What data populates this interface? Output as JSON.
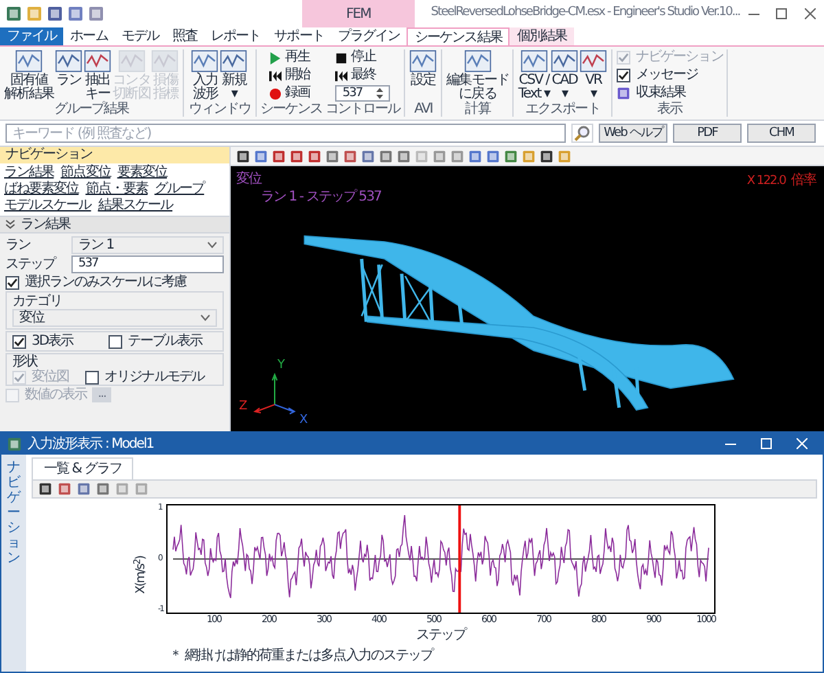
{
  "title_bar": {
    "title": "SteelReversedLohseBridge-CM.esx - Engineer's Studio Ver.10...",
    "context_tab": "FEM"
  },
  "tabs": [
    {
      "label": "ファイル",
      "kind": "file",
      "selected": false
    },
    {
      "label": "ホーム",
      "kind": "normal",
      "selected": false
    },
    {
      "label": "モデル",
      "kind": "normal",
      "selected": false
    },
    {
      "label": "照査",
      "kind": "normal",
      "selected": false
    },
    {
      "label": "レポート",
      "kind": "normal",
      "selected": false
    },
    {
      "label": "サポート",
      "kind": "normal",
      "selected": false
    },
    {
      "label": "プラグイン",
      "kind": "normal",
      "selected": false
    },
    {
      "label": "シーケンス結果",
      "kind": "context",
      "selected": true
    },
    {
      "label": "個別結果",
      "kind": "context",
      "selected": false
    }
  ],
  "ribbon_groups": [
    {
      "label": "グループ結果",
      "kind": "buttons",
      "items": [
        {
          "lines": [
            "固有値",
            "解析結果"
          ],
          "disabled": false
        },
        {
          "lines": [
            "ラン"
          ],
          "disabled": false
        },
        {
          "lines": [
            "抽出",
            "キー"
          ],
          "disabled": false
        },
        {
          "lines": [
            "コンタ",
            "切断図"
          ],
          "disabled": true
        },
        {
          "lines": [
            "損傷",
            "指標"
          ],
          "disabled": true
        }
      ]
    },
    {
      "label": "ウィンドウ",
      "kind": "buttons",
      "items": [
        {
          "lines": [
            "入力",
            "波形"
          ],
          "disabled": false
        },
        {
          "lines": [
            "新規",
            "▾"
          ],
          "disabled": false
        }
      ]
    },
    {
      "label": "シーケンス コントロール",
      "kind": "sequence",
      "items": [
        {
          "lines": [
            "再生"
          ]
        },
        {
          "lines": [
            "停止"
          ]
        },
        {
          "lines": [
            "開始"
          ]
        },
        {
          "lines": [
            "最終"
          ]
        },
        {
          "lines": [
            "録画"
          ]
        }
      ],
      "step": "537"
    },
    {
      "label": "AVI",
      "kind": "buttons",
      "items": [
        {
          "lines": [
            "設定"
          ],
          "disabled": false
        }
      ]
    },
    {
      "label": "計算",
      "kind": "buttons",
      "items": [
        {
          "lines": [
            "編集モード",
            "に戻る"
          ],
          "disabled": false
        }
      ]
    },
    {
      "label": "エクスポート",
      "kind": "buttons",
      "items": [
        {
          "lines": [
            "CSV /",
            "Text ▾"
          ],
          "disabled": false
        },
        {
          "lines": [
            "CAD",
            "▾"
          ],
          "disabled": false
        },
        {
          "lines": [
            "VR",
            "▾"
          ],
          "disabled": false
        }
      ]
    },
    {
      "label": "表示",
      "kind": "checks",
      "items": [
        {
          "lines": [
            "ナビゲーション"
          ],
          "kind": "check",
          "checked": true,
          "disabled": true
        },
        {
          "lines": [
            "メッセージ"
          ],
          "kind": "check",
          "checked": true,
          "disabled": false
        },
        {
          "lines": [
            "収束結果"
          ],
          "kind": "icon"
        }
      ]
    }
  ],
  "search": {
    "placeholder": "キーワード (例 照査など)",
    "buttons": [
      "Web ヘルプ",
      "PDF",
      "CHM"
    ]
  },
  "navigation": {
    "title": "ナビゲーション",
    "links": [
      "ラン結果",
      "節点変位",
      "要素変位",
      "ばね要素変位",
      "節点・要素",
      "グループ",
      "モデルスケール",
      "結果スケール"
    ],
    "section": "ラン結果",
    "run": {
      "label": "ラン",
      "value": "ラン 1"
    },
    "step": {
      "label": "ステップ",
      "value": "537"
    },
    "scale_only_selected": {
      "label": "選択ランのみスケールに考慮",
      "checked": true
    },
    "category": {
      "label": "カテゴリ",
      "value": "変位"
    },
    "show_3d": {
      "label": "3D表示",
      "checked": true
    },
    "show_table": {
      "label": "テーブル表示",
      "checked": false
    },
    "shape": {
      "label": "形状",
      "displacement": {
        "label": "変位図",
        "checked": true,
        "disabled": true
      },
      "original": {
        "label": "オリジナルモデル",
        "checked": false
      }
    },
    "values": {
      "label": "数値の表示",
      "checked": false,
      "disabled": true,
      "button": "..."
    }
  },
  "viewport": {
    "title": "変位",
    "subtitle": "ラン 1 - ステップ 537",
    "scale": "X 122.0",
    "scale_label": "倍率",
    "axes": [
      "Y",
      "Z",
      "X"
    ]
  },
  "wave_window": {
    "title": "入力波形表示 : Model1",
    "side_tab": "ナビゲーション",
    "tab": "一覧 & グラフ",
    "chart": {
      "ylabel": "X(m/s$^{2}$)",
      "yticks": [
        "1",
        "0",
        "-1"
      ],
      "xticks": [
        "100",
        "200",
        "300",
        "400",
        "500",
        "600",
        "700",
        "800",
        "900",
        "1000"
      ],
      "xlabel": "ステップ",
      "note": "＊ 網掛けは静的荷重または多点入力のステップ"
    }
  }
}
